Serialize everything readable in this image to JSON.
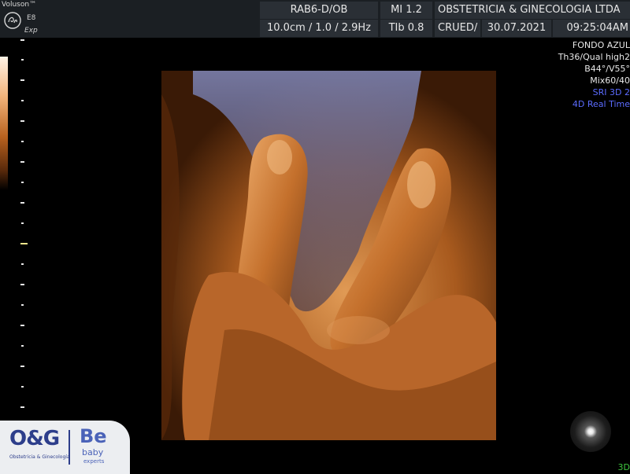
{
  "header": {
    "brand": "Voluson™",
    "model": "E8",
    "mode": "Exp",
    "probe": "RAB6-D/OB",
    "mi": "MI  1.2",
    "institution": "OBSTETRICIA & GINECOLOGIA LTDA",
    "depth_freq": "10.0cm / 1.0 / 2.9Hz",
    "tib": "TIb  0.8",
    "operator": "CRUED/",
    "date": "30.07.2021",
    "time": "09:25:04AM"
  },
  "info_panel": {
    "lines": [
      "FONDO AZUL",
      "Th36/Qual high2",
      "B44°/V55°",
      "Mix60/40"
    ],
    "render_mode": "SRI 3D 2",
    "realtime": "4D Real Time",
    "accent_color": "#5b6bff"
  },
  "footer": {
    "logo_og": "O&G",
    "logo_og_sub": "Obstetricia & Ginecología",
    "logo_be": "Be",
    "logo_be_baby": "baby",
    "logo_be_experts": "experts",
    "label_3d": "3D"
  },
  "colors": {
    "render_bronze": "#c06a26",
    "scale_marker": "#f0e68c",
    "status_green": "#3dc43d"
  }
}
